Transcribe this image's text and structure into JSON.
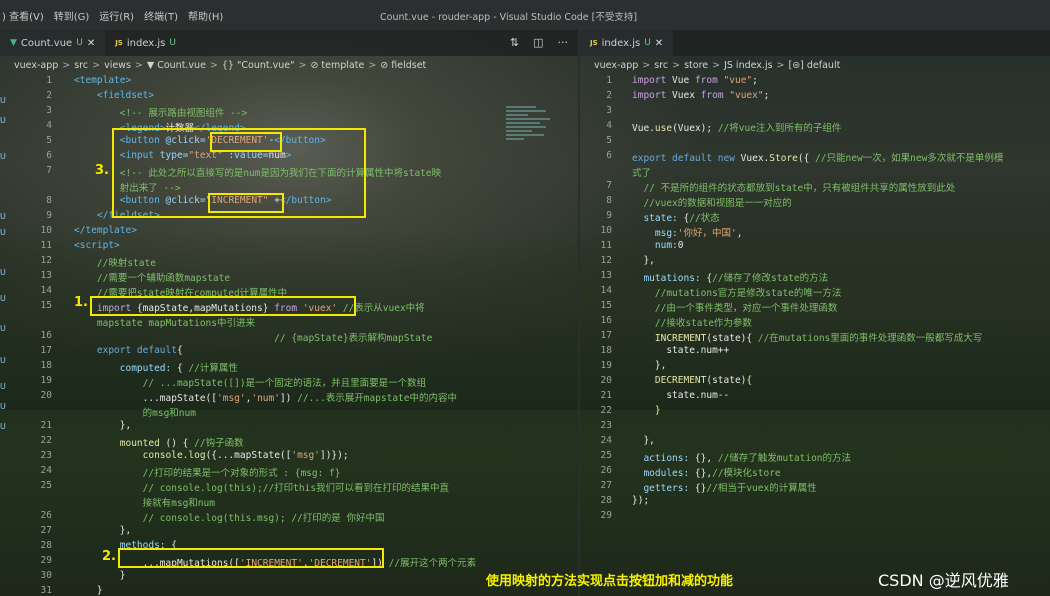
{
  "window": {
    "menu": [
      ") 查看(V)",
      "转到(G)",
      "运行(R)",
      "终端(T)",
      "帮助(H)"
    ],
    "title": "Count.vue - rouder-app - Visual Studio Code [不受支持]"
  },
  "left_editor": {
    "tabs": [
      {
        "icon": "▼",
        "label": "Count.vue",
        "status": "U",
        "close": "✕"
      },
      {
        "icon": "JS",
        "label": "index.js",
        "status": "U"
      }
    ],
    "breadcrumb": [
      "vuex-app",
      "src",
      "views",
      "▼ Count.vue",
      "{} \"Count.vue\"",
      "⊘ template",
      "⊘ fieldset"
    ],
    "tools": [
      "⇅",
      "◫",
      "···"
    ]
  },
  "right_editor": {
    "tabs": [
      {
        "icon": "JS",
        "label": "index.js",
        "status": "U",
        "close": "✕"
      }
    ],
    "breadcrumb": [
      "vuex-app",
      "src",
      "store",
      "JS index.js",
      "[⊜] default"
    ]
  },
  "left_lines": [
    {
      "n": "1",
      "parts": [
        [
          "t",
          "<template>"
        ]
      ]
    },
    {
      "n": "2",
      "parts": [
        [
          "t",
          "    <fieldset>"
        ]
      ]
    },
    {
      "n": "3",
      "parts": [
        [
          "c",
          "        <!-- 展示路由视图组件 -->"
        ]
      ]
    },
    {
      "n": "4",
      "parts": [
        [
          "t",
          "        <legend>"
        ],
        [
          "w",
          "计数器"
        ],
        [
          "t",
          "</legend>"
        ]
      ]
    },
    {
      "n": "5",
      "parts": [
        [
          "t",
          "        <button "
        ],
        [
          "v",
          "@click="
        ],
        [
          "s",
          "'DECREMENT'"
        ],
        [
          "w",
          "-"
        ],
        [
          "t",
          "</button>"
        ]
      ]
    },
    {
      "n": "6",
      "parts": [
        [
          "t",
          "        <input "
        ],
        [
          "v",
          "type="
        ],
        [
          "s",
          "\"text\""
        ],
        [
          "v",
          " :value="
        ],
        [
          "w",
          "num"
        ],
        [
          "t",
          ">"
        ]
      ]
    },
    {
      "n": "7",
      "parts": [
        [
          "c",
          "        <!-- 此处之所以直接写的是num是因为我们在下面的计算属性中将state映"
        ]
      ]
    },
    {
      "n": "",
      "parts": [
        [
          "c",
          "        射出来了 -->"
        ]
      ]
    },
    {
      "n": "8",
      "parts": [
        [
          "t",
          "        <button "
        ],
        [
          "v",
          "@click="
        ],
        [
          "s",
          "\"INCREMENT\""
        ],
        [
          "w",
          " +"
        ],
        [
          "t",
          "</button>"
        ]
      ]
    },
    {
      "n": "9",
      "parts": [
        [
          "t",
          "    </fieldset>"
        ]
      ]
    },
    {
      "n": "10",
      "parts": [
        [
          "t",
          "</template>"
        ]
      ]
    },
    {
      "n": "11",
      "parts": [
        [
          "t",
          "<script>"
        ]
      ]
    },
    {
      "n": "12",
      "parts": [
        [
          "c",
          "    //映射state"
        ]
      ]
    },
    {
      "n": "13",
      "parts": [
        [
          "c",
          "    //需要一个辅助函数mapstate"
        ]
      ]
    },
    {
      "n": "14",
      "parts": [
        [
          "c",
          "    //需要把state映射在computed计算属性中"
        ]
      ]
    },
    {
      "n": "15",
      "parts": [
        [
          "p",
          "    import "
        ],
        [
          "w",
          "{mapState,mapMutations} "
        ],
        [
          "p",
          "from "
        ],
        [
          "s",
          "'vuex'"
        ],
        [
          "c",
          " //表示从vuex中将"
        ]
      ]
    },
    {
      "n": "",
      "parts": [
        [
          "c",
          "    mapstate mapMutations中引进来"
        ]
      ]
    },
    {
      "n": "16",
      "parts": [
        [
          "c",
          "                                   // {mapState}表示解构mapState"
        ]
      ]
    },
    {
      "n": "17",
      "parts": [
        [
          "k",
          "    export default"
        ],
        [
          "w",
          "{"
        ]
      ]
    },
    {
      "n": "18",
      "parts": [
        [
          "v",
          "        computed: "
        ],
        [
          "w",
          "{ "
        ],
        [
          "c",
          "//计算属性"
        ]
      ]
    },
    {
      "n": "19",
      "parts": [
        [
          "c",
          "            // ...mapState([])是一个固定的语法，并且里面要是一个数组"
        ]
      ]
    },
    {
      "n": "20",
      "parts": [
        [
          "w",
          "            ...mapState(["
        ],
        [
          "s",
          "'msg'"
        ],
        [
          "w",
          ","
        ],
        [
          "s",
          "'num'"
        ],
        [
          "w",
          "]) "
        ],
        [
          "c",
          "//...表示展开mapstate中的内容中"
        ]
      ]
    },
    {
      "n": "",
      "parts": [
        [
          "c",
          "            的msg和num"
        ]
      ]
    },
    {
      "n": "21",
      "parts": [
        [
          "w",
          "        },"
        ]
      ]
    },
    {
      "n": "22",
      "parts": [
        [
          "f",
          "        mounted "
        ],
        [
          "w",
          "() { "
        ],
        [
          "c",
          "//钩子函数"
        ]
      ]
    },
    {
      "n": "23",
      "parts": [
        [
          "f",
          "            console.log"
        ],
        [
          "w",
          "({...mapState(["
        ],
        [
          "s",
          "'msg'"
        ],
        [
          "w",
          "])});"
        ]
      ]
    },
    {
      "n": "24",
      "parts": [
        [
          "c",
          "            //打印的结果是一个对象的形式 : {msg: f}"
        ]
      ]
    },
    {
      "n": "25",
      "parts": [
        [
          "c",
          "            // console.log(this);//打印this我们可以看到在打印的结果中直"
        ]
      ]
    },
    {
      "n": "",
      "parts": [
        [
          "c",
          "            接就有msg和num"
        ]
      ]
    },
    {
      "n": "26",
      "parts": [
        [
          "c",
          "            // console.log(this.msg); //打印的是 你好中国"
        ]
      ]
    },
    {
      "n": "27",
      "parts": [
        [
          "w",
          "        },"
        ]
      ]
    },
    {
      "n": "28",
      "parts": [
        [
          "v",
          "        methods: "
        ],
        [
          "w",
          "{"
        ]
      ]
    },
    {
      "n": "29",
      "parts": [
        [
          "w",
          "            ...mapMutations(["
        ],
        [
          "s",
          "'INCREMENT'"
        ],
        [
          "w",
          ","
        ],
        [
          "s",
          "'DECREMENT'"
        ],
        [
          "w",
          "]) "
        ],
        [
          "c",
          "//展开这个两个元素"
        ]
      ]
    },
    {
      "n": "30",
      "parts": [
        [
          "w",
          "        }"
        ]
      ]
    },
    {
      "n": "31",
      "parts": [
        [
          "w",
          "    }"
        ]
      ]
    }
  ],
  "right_lines": [
    {
      "n": "1",
      "parts": [
        [
          "p",
          "import "
        ],
        [
          "w",
          "Vue "
        ],
        [
          "p",
          "from "
        ],
        [
          "s",
          "\"vue\""
        ],
        [
          "w",
          ";"
        ]
      ]
    },
    {
      "n": "2",
      "parts": [
        [
          "p",
          "import "
        ],
        [
          "w",
          "Vuex "
        ],
        [
          "p",
          "from "
        ],
        [
          "s",
          "\"vuex\""
        ],
        [
          "w",
          ";"
        ]
      ]
    },
    {
      "n": "3",
      "parts": []
    },
    {
      "n": "4",
      "parts": [
        [
          "w",
          "Vue."
        ],
        [
          "f",
          "use"
        ],
        [
          "w",
          "(Vuex); "
        ],
        [
          "c",
          "//将vue注入到所有的子组件"
        ]
      ]
    },
    {
      "n": "5",
      "parts": []
    },
    {
      "n": "6",
      "parts": [
        [
          "k",
          "export default new "
        ],
        [
          "w",
          "Vuex."
        ],
        [
          "f",
          "Store"
        ],
        [
          "w",
          "({ "
        ],
        [
          "c",
          "//只能new一次，如果new多次就不是单例模"
        ]
      ]
    },
    {
      "n": "",
      "parts": [
        [
          "c",
          "式了"
        ]
      ]
    },
    {
      "n": "7",
      "parts": [
        [
          "c",
          "  // 不是所的组件的状态都放到state中，只有被组件共享的属性放到此处"
        ]
      ]
    },
    {
      "n": "8",
      "parts": [
        [
          "c",
          "  //vuex的数据和视图是一一对应的"
        ]
      ]
    },
    {
      "n": "9",
      "parts": [
        [
          "v",
          "  state: "
        ],
        [
          "w",
          "{"
        ],
        [
          "c",
          "//状态"
        ]
      ]
    },
    {
      "n": "10",
      "parts": [
        [
          "v",
          "    msg:"
        ],
        [
          "s",
          "'你好，中国'"
        ],
        [
          "w",
          ","
        ]
      ]
    },
    {
      "n": "11",
      "parts": [
        [
          "v",
          "    num:"
        ],
        [
          "w",
          "0"
        ]
      ]
    },
    {
      "n": "12",
      "parts": [
        [
          "w",
          "  },"
        ]
      ]
    },
    {
      "n": "13",
      "parts": [
        [
          "v",
          "  mutations: "
        ],
        [
          "w",
          "{"
        ],
        [
          "c",
          "//储存了修改state的方法"
        ]
      ]
    },
    {
      "n": "14",
      "parts": [
        [
          "c",
          "    //mutations官方是修改state的唯一方法"
        ]
      ]
    },
    {
      "n": "15",
      "parts": [
        [
          "c",
          "    //由一个事件类型，对应一个事件处理函数"
        ]
      ]
    },
    {
      "n": "16",
      "parts": [
        [
          "c",
          "    //接收state作为参数"
        ]
      ]
    },
    {
      "n": "17",
      "parts": [
        [
          "f",
          "    INCREMENT"
        ],
        [
          "w",
          "(state){ "
        ],
        [
          "c",
          "//在mutations里面的事件处理函数一般都写成大写"
        ]
      ]
    },
    {
      "n": "18",
      "parts": [
        [
          "w",
          "      state.num++"
        ]
      ]
    },
    {
      "n": "19",
      "parts": [
        [
          "w",
          "    },"
        ]
      ]
    },
    {
      "n": "20",
      "parts": [
        [
          "f",
          "    DECREMENT"
        ],
        [
          "w",
          "(state)"
        ],
        [
          "f",
          "{"
        ]
      ]
    },
    {
      "n": "21",
      "parts": [
        [
          "w",
          "      state.num--"
        ]
      ]
    },
    {
      "n": "22",
      "parts": [
        [
          "f",
          "    }"
        ]
      ]
    },
    {
      "n": "23",
      "parts": []
    },
    {
      "n": "24",
      "parts": [
        [
          "w",
          "  },"
        ]
      ]
    },
    {
      "n": "25",
      "parts": [
        [
          "v",
          "  actions: "
        ],
        [
          "w",
          "{}, "
        ],
        [
          "c",
          "//储存了触发mutation的方法"
        ]
      ]
    },
    {
      "n": "26",
      "parts": [
        [
          "v",
          "  modules: "
        ],
        [
          "w",
          "{},"
        ],
        [
          "c",
          "//模块化store"
        ]
      ]
    },
    {
      "n": "27",
      "parts": [
        [
          "v",
          "  getters: "
        ],
        [
          "w",
          "{}"
        ],
        [
          "c",
          "//相当于vuex的计算属性"
        ]
      ]
    },
    {
      "n": "28",
      "parts": [
        [
          "w",
          "});"
        ]
      ]
    },
    {
      "n": "29",
      "parts": []
    }
  ],
  "annotations": {
    "n1": "1.",
    "n2": "2.",
    "n3": "3.",
    "caption": "使用映射的方法实现点击按钮加和减的功能",
    "watermark": "CSDN @逆风优雅"
  },
  "gutter_marks": [
    "U",
    "U",
    "U",
    "U",
    "U",
    "U",
    "U",
    "U",
    "U",
    "U",
    "U",
    "U"
  ],
  "colors": {
    "highlight": "#f3e800",
    "comment": "#7fbf6a",
    "keyword": "#6aa9e0",
    "string": "#e2a57a"
  }
}
